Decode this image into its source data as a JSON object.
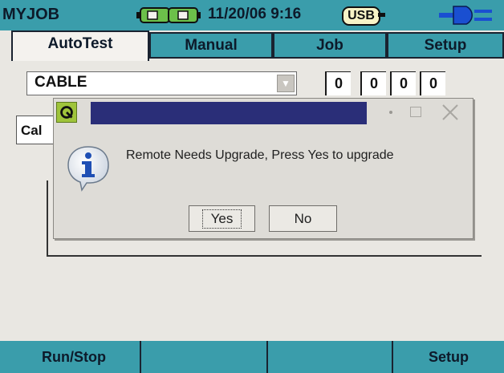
{
  "status_bar": {
    "job_name": "MYJOB",
    "date_time": "11/20/06 9:16",
    "usb_label": "USB",
    "battery_icon": "battery-icon",
    "power_icon": "power-plug-icon"
  },
  "tabs": [
    {
      "label": "AutoTest",
      "active": true
    },
    {
      "label": "Manual",
      "active": false
    },
    {
      "label": "Job",
      "active": false
    },
    {
      "label": "Setup",
      "active": false
    }
  ],
  "main": {
    "cable_type": "CABLE",
    "counters": [
      "0",
      "0",
      "0",
      "0"
    ],
    "obscured_label": "Cal"
  },
  "dialog": {
    "title": "",
    "message": "Remote Needs Upgrade, Press Yes to upgrade",
    "yes_label": "Yes",
    "no_label": "No",
    "icon": "info-icon"
  },
  "softkeys": [
    {
      "label": "Run/Stop"
    },
    {
      "label": ""
    },
    {
      "label": ""
    },
    {
      "label": "Setup"
    }
  ],
  "colors": {
    "bar_teal": "#3a9dab",
    "title_navy": "#2a2e78",
    "battery_green": "#5db33a"
  }
}
